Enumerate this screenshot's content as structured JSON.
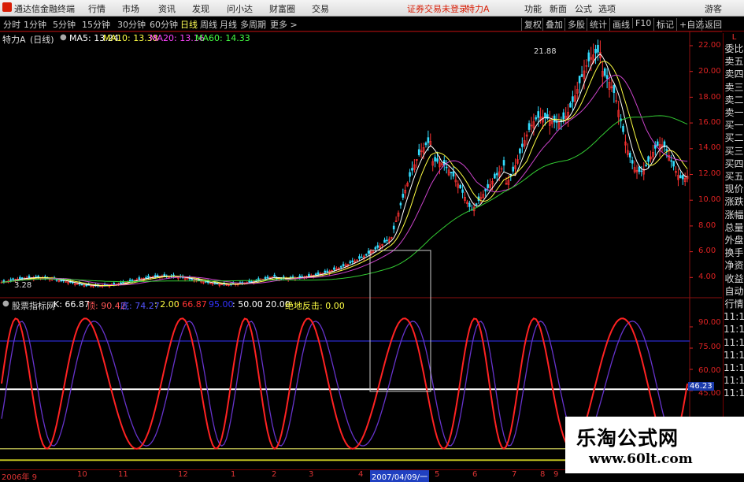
{
  "menubar": {
    "app_title": "通达信金融终端",
    "menus": [
      "行情",
      "市场",
      "资讯",
      "发现",
      "问小达",
      "财富圈",
      "交易"
    ],
    "status": "证券交易未登录",
    "stock": "特力A",
    "right": [
      "功能",
      "新面",
      "公式",
      "选项",
      "游客"
    ]
  },
  "toolbar": {
    "periods": [
      "分时",
      "1分钟",
      "5分钟",
      "15分钟",
      "30分钟",
      "60分钟",
      "日线",
      "周线",
      "月线",
      "多周期",
      "更多 >"
    ],
    "active_period": "日线",
    "right_buttons": [
      "复权",
      "叠加",
      "多股",
      "统计",
      "画线",
      "F10",
      "标记",
      "+自选",
      "返回"
    ]
  },
  "main_chart": {
    "stock_label": "特力A",
    "period_label": "(日线)",
    "ma": [
      {
        "label": "MA5: 13.24",
        "color": "#ffffff"
      },
      {
        "label": "MA10: 13.38",
        "color": "#ffff44"
      },
      {
        "label": "MA20: 13.16",
        "color": "#ff44ff"
      },
      {
        "label": "MA60: 14.33",
        "color": "#44ff44"
      }
    ],
    "y_ticks": [
      "22.00",
      "20.00",
      "18.00",
      "16.00",
      "14.00",
      "12.00",
      "10.00",
      "8.00",
      "6.00",
      "4.00"
    ],
    "high_annotation": "21.88",
    "low_annotation": "3.28"
  },
  "indicator": {
    "name": "股票指标网",
    "values": [
      {
        "label": "K: 66.87",
        "color": "#ffffff"
      },
      {
        "label": "顶: 90.42",
        "color": "#ff5555"
      },
      {
        "label": "底: 74.27",
        "color": "#5555ff"
      },
      {
        "label": ": 2.00",
        "color": "#ffff44"
      },
      {
        "label": ": 66.87",
        "color": "#ff3333"
      },
      {
        "label": "95.00",
        "color": "#3333ff"
      },
      {
        "label": ": 50.00",
        "color": "#ffffff"
      },
      {
        "label": ": 20.00",
        "color": "#ffffff"
      },
      {
        "label": "绝地反击: 0.00",
        "color": "#ffff44"
      }
    ],
    "y_ticks": [
      "90.00",
      "75.00",
      "60.00",
      "45.00"
    ],
    "current_value": "46.23"
  },
  "sidebar": {
    "badges": [
      "L",
      "L"
    ],
    "items": [
      "委比",
      "卖五",
      "卖四",
      "卖三",
      "卖二",
      "卖一",
      "买一",
      "买二",
      "买三",
      "买四",
      "买五",
      "现价",
      "涨跌",
      "涨幅",
      "总量",
      "外盘",
      "换手",
      "净资",
      "收益",
      "自动",
      "行情",
      "11:1",
      "11:1",
      "11:1",
      "11:1",
      "11:1",
      "11:1",
      "11:1"
    ]
  },
  "datebar": {
    "labels": [
      "2006年 9",
      "10",
      "11",
      "12",
      "1",
      "2",
      "3",
      "4",
      "5",
      "6",
      "7",
      "8",
      "9",
      "10"
    ],
    "highlight": "2007/04/09/一"
  },
  "watermark": {
    "title": "乐淘公式网",
    "url": "www.60lt.com"
  },
  "colors": {
    "ma5": "#ffffff",
    "ma10": "#ffff44",
    "ma20": "#cc44cc",
    "ma60": "#33cc33",
    "k_line": "#ff2222",
    "d_line": "#6633cc",
    "axis_red": "#dd2222"
  }
}
